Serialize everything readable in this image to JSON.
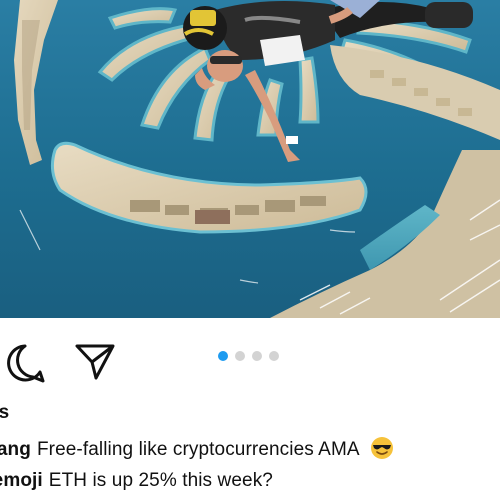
{
  "post": {
    "photo": {
      "image": "skydiver-over-palm-island-photo"
    },
    "actions": {
      "comment_icon": "speech-bubble-icon",
      "share_icon": "paper-plane-icon"
    },
    "carousel": {
      "total": 4,
      "active_index": 0
    },
    "likes_text": "es",
    "caption": {
      "username": "wang",
      "text": "Free-falling like cryptocurrencies AMA",
      "emoji_icon": "sunglasses-emoji-icon"
    },
    "comments": [
      {
        "username": "_emoji",
        "text": "ETH is up 25% this week?"
      }
    ]
  },
  "colors": {
    "accent_dot": "#1d9bf0",
    "inactive_dot": "#d3d3d3",
    "sea": "#1a6f93",
    "text": "#111111"
  }
}
